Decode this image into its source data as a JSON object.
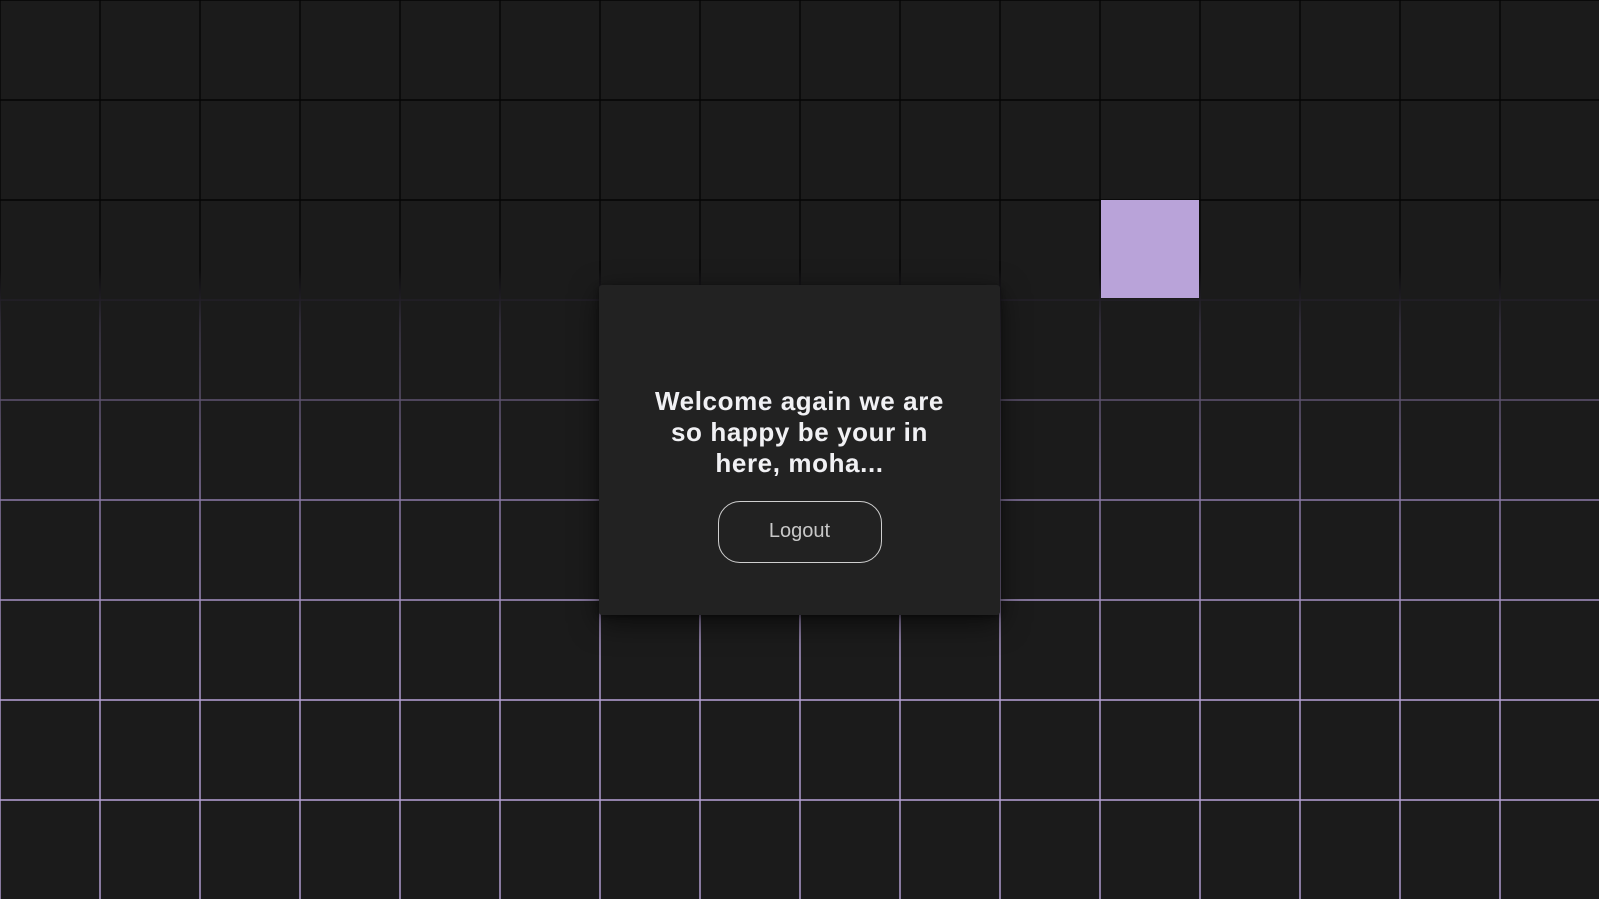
{
  "colors": {
    "background": "#1b1b1b",
    "grid_line_dark": "#050505",
    "grid_line_accent": "#b8a3d8",
    "highlight_tile": "#b9a3d9",
    "card": "#222222",
    "title_text": "#f1f1f4",
    "button_border": "#cfcfcf",
    "button_text": "#c8c8c8"
  },
  "welcome": {
    "message": "Welcome again we are so happy be your in here, moha...",
    "logout_label": "Logout"
  }
}
